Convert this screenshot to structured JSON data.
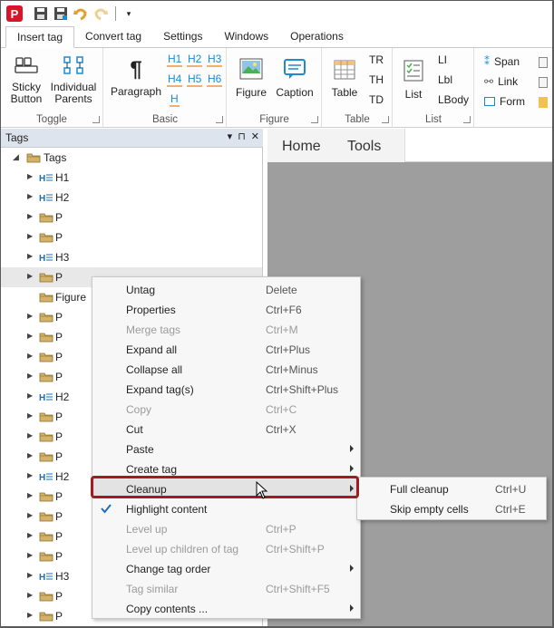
{
  "qat": {
    "logo_letter": "P"
  },
  "tabs": [
    "Insert tag",
    "Convert tag",
    "Settings",
    "Windows",
    "Operations"
  ],
  "ribbon": {
    "toggle": {
      "label": "Toggle",
      "sticky": "Sticky\nButton",
      "individual": "Individual\nParents"
    },
    "basic": {
      "label": "Basic",
      "paragraph": "Paragraph",
      "headings": [
        "H1",
        "H2",
        "H3",
        "H4",
        "H5",
        "H6",
        "H"
      ]
    },
    "figure": {
      "label": "Figure",
      "figure": "Figure",
      "caption": "Caption"
    },
    "table": {
      "label": "Table",
      "table": "Table",
      "tr": "TR",
      "th": "TH",
      "td": "TD"
    },
    "list": {
      "label": "List",
      "list": "List",
      "li": "LI",
      "lbl": "Lbl",
      "lbody": "LBody"
    },
    "inline": {
      "span": "Span",
      "link": "Link",
      "form": "Form"
    }
  },
  "panel": {
    "title": "Tags",
    "controls": [
      "▾",
      "⊓",
      "✕"
    ]
  },
  "tree": {
    "root": "Tags",
    "items": [
      {
        "label": "H1",
        "kind": "heading"
      },
      {
        "label": "H2",
        "kind": "heading"
      },
      {
        "label": "P",
        "kind": "tag"
      },
      {
        "label": "P",
        "kind": "tag"
      },
      {
        "label": "H3",
        "kind": "heading"
      },
      {
        "label": "P",
        "kind": "tag"
      },
      {
        "label": "Figure",
        "kind": "tag"
      },
      {
        "label": "P",
        "kind": "tag"
      },
      {
        "label": "P",
        "kind": "tag"
      },
      {
        "label": "P",
        "kind": "tag"
      },
      {
        "label": "P",
        "kind": "tag"
      },
      {
        "label": "H2",
        "kind": "heading"
      },
      {
        "label": "P",
        "kind": "tag"
      },
      {
        "label": "P",
        "kind": "tag"
      },
      {
        "label": "P",
        "kind": "tag"
      },
      {
        "label": "H2",
        "kind": "heading"
      },
      {
        "label": "P",
        "kind": "tag"
      },
      {
        "label": "P",
        "kind": "tag"
      },
      {
        "label": "P",
        "kind": "tag"
      },
      {
        "label": "P",
        "kind": "tag"
      },
      {
        "label": "H3",
        "kind": "heading"
      },
      {
        "label": "P",
        "kind": "tag"
      },
      {
        "label": "P",
        "kind": "tag"
      }
    ]
  },
  "doc_nav": {
    "home": "Home",
    "tools": "Tools"
  },
  "context_menu": {
    "items": [
      {
        "label": "Untag",
        "shortcut": "Delete",
        "disabled": false
      },
      {
        "label": "Properties",
        "shortcut": "Ctrl+F6",
        "disabled": false
      },
      {
        "label": "Merge tags",
        "shortcut": "Ctrl+M",
        "disabled": true
      },
      {
        "label": "Expand all",
        "shortcut": "Ctrl+Plus",
        "disabled": false
      },
      {
        "label": "Collapse all",
        "shortcut": "Ctrl+Minus",
        "disabled": false
      },
      {
        "label": "Expand tag(s)",
        "shortcut": "Ctrl+Shift+Plus",
        "disabled": false
      },
      {
        "label": "Copy",
        "shortcut": "Ctrl+C",
        "disabled": true
      },
      {
        "label": "Cut",
        "shortcut": "Ctrl+X",
        "disabled": false
      },
      {
        "label": "Paste",
        "shortcut": "",
        "disabled": false
      },
      {
        "label": "Create tag",
        "shortcut": "",
        "disabled": false
      },
      {
        "label": "Cleanup",
        "shortcut": "",
        "disabled": false
      },
      {
        "label": "Highlight content",
        "shortcut": "",
        "disabled": false
      },
      {
        "label": "Level up",
        "shortcut": "Ctrl+P",
        "disabled": true
      },
      {
        "label": "Level up children of tag",
        "shortcut": "Ctrl+Shift+P",
        "disabled": true
      },
      {
        "label": "Change tag order",
        "shortcut": "",
        "disabled": false
      },
      {
        "label": "Tag similar",
        "shortcut": "Ctrl+Shift+F5",
        "disabled": true
      },
      {
        "label": "Copy contents ...",
        "shortcut": "",
        "disabled": false
      }
    ]
  },
  "submenu": {
    "items": [
      {
        "label": "Full cleanup",
        "shortcut": "Ctrl+U"
      },
      {
        "label": "Skip empty cells",
        "shortcut": "Ctrl+E"
      }
    ]
  },
  "colors": {
    "accent_blue": "#1a8ccf",
    "highlight_red": "#a01b24",
    "doc_gray": "#9e9e9e",
    "tag_folder": "#d4b26a"
  }
}
